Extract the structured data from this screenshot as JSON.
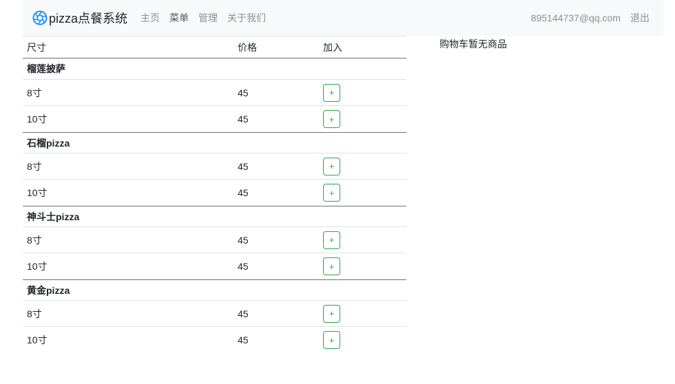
{
  "navbar": {
    "brand": "pizza点餐系统",
    "links": [
      {
        "label": "主页",
        "active": false
      },
      {
        "label": "菜单",
        "active": true
      },
      {
        "label": "管理",
        "active": false
      },
      {
        "label": "关于我们",
        "active": false
      }
    ],
    "email": "895144737@qq.com",
    "logout": "退出"
  },
  "menu": {
    "headers": {
      "size": "尺寸",
      "price": "价格",
      "add": "加入"
    },
    "add_symbol": "+",
    "groups": [
      {
        "name": "榴莲披萨",
        "items": [
          {
            "size": "8寸",
            "price": "45"
          },
          {
            "size": "10寸",
            "price": "45"
          }
        ]
      },
      {
        "name": "石榴pizza",
        "items": [
          {
            "size": "8寸",
            "price": "45"
          },
          {
            "size": "10寸",
            "price": "45"
          }
        ]
      },
      {
        "name": "神斗士pizza",
        "items": [
          {
            "size": "8寸",
            "price": "45"
          },
          {
            "size": "10寸",
            "price": "45"
          }
        ]
      },
      {
        "name": "黄金pizza",
        "items": [
          {
            "size": "8寸",
            "price": "45"
          },
          {
            "size": "10寸",
            "price": "45"
          }
        ]
      }
    ]
  },
  "cart": {
    "empty_text": "购物车暂无商品"
  },
  "colors": {
    "accent": "#28a745",
    "brand_icon": "#1e90ff",
    "navbar_bg": "#f8f9fa"
  }
}
